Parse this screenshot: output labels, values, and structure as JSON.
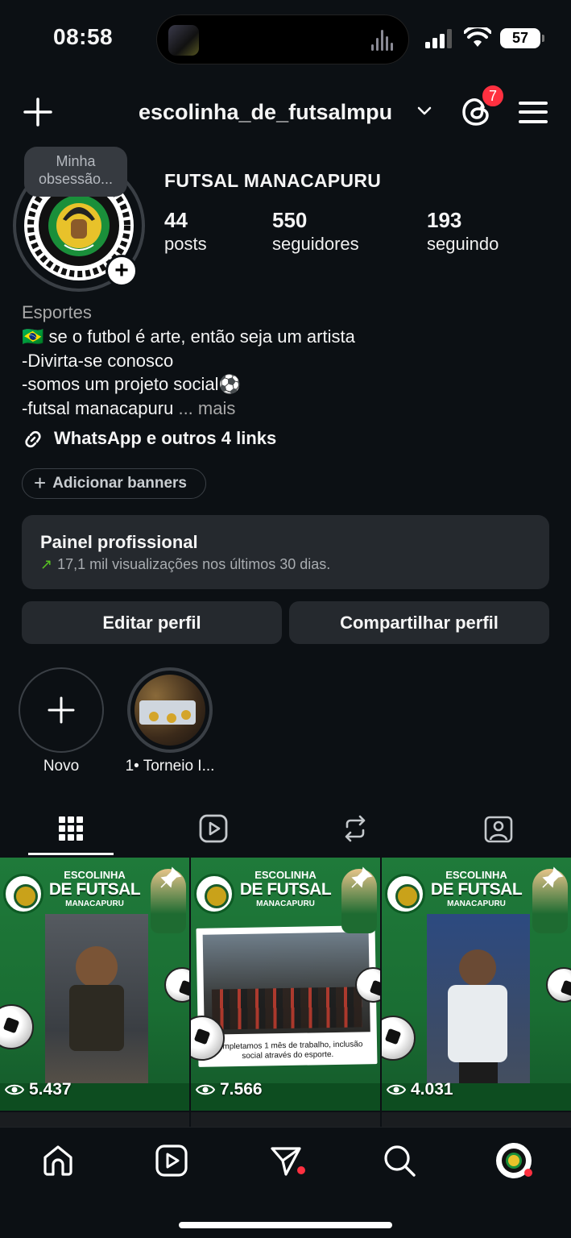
{
  "status": {
    "time": "08:58",
    "battery": "57"
  },
  "header": {
    "username": "escolinha_de_futsalmpu",
    "notifications": "7"
  },
  "profile": {
    "note": "Minha obsessão...",
    "name": "FUTSAL MANACAPURU",
    "stats": [
      {
        "value": "44",
        "label": "posts"
      },
      {
        "value": "550",
        "label": "seguidores"
      },
      {
        "value": "193",
        "label": "seguindo"
      }
    ],
    "category": "Esportes",
    "bio": [
      "🇧🇷 se o futbol é arte, então seja um artista",
      "-Divirta-se conosco",
      "-somos um projeto social⚽",
      "-futsal manacapuru"
    ],
    "bio_more": "... mais",
    "links": "WhatsApp e outros 4 links",
    "add_banners": "Adicionar banners"
  },
  "dashboard": {
    "title": "Painel profissional",
    "subtitle": "17,1 mil visualizações nos últimos 30 dias."
  },
  "actions": {
    "edit": "Editar perfil",
    "share": "Compartilhar perfil"
  },
  "highlights": [
    {
      "label": "Novo"
    },
    {
      "label": "1• Torneio I..."
    }
  ],
  "tabs": [
    "grid-icon",
    "reels-icon",
    "reposts-icon",
    "tagged-icon"
  ],
  "posts": [
    {
      "title1": "ESCOLINHA",
      "title2": "DE FUTSAL",
      "title3": "MANACAPURU",
      "views": "5.437"
    },
    {
      "title1": "ESCOLINHA",
      "title2": "DE FUTSAL",
      "title3": "MANACAPURU",
      "views": "7.566",
      "caption": "Completamos 1 mês de trabalho, inclusão social através do esporte."
    },
    {
      "title1": "ESCOLINHA",
      "title2": "DE FUTSAL",
      "title3": "MANACAPURU",
      "views": "4.031"
    }
  ],
  "colors": {
    "background": "#0c1014",
    "surface": "#25292e",
    "accent_badge": "#ff3040",
    "trend": "#58c322",
    "post_green": "#1f7a3a"
  }
}
